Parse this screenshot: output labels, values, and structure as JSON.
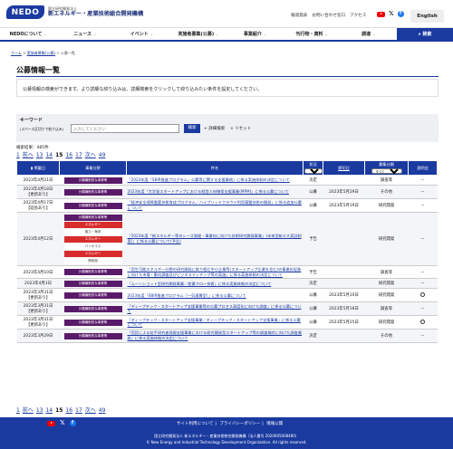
{
  "header": {
    "org_small": "国立研究開発法人",
    "org_name": "新エネルギー・産業技術総合開発機構",
    "logo": "NEDO",
    "links": [
      "報道発表",
      "お問い合わせ窓口",
      "アクセス"
    ],
    "lang": "English"
  },
  "gnav": {
    "items": [
      "NEDOについて",
      "ニュース",
      "イベント",
      "実施者募集(公募)",
      "事業紹介",
      "刊行物・資料",
      "調達"
    ],
    "search": "検索"
  },
  "breadcrumb": [
    "ホーム",
    "実施者募集(公募)",
    "公募一覧"
  ],
  "page": {
    "title": "公募情報一覧",
    "intro": "公募情報の検索ができます。より詳細な絞り込みは、詳細検索をクリックして絞り込みたい条件を設定してください。"
  },
  "search": {
    "label": "キーワード",
    "sublabel": "(スペース区切りで絞り込み)",
    "placeholder": "入力してください",
    "button": "検索",
    "detail": "詳細検索",
    "reset": "リセット"
  },
  "results": {
    "count": "検索結果：485件",
    "pager": [
      "1",
      "前へ",
      "13",
      "14",
      "15",
      "16",
      "17",
      "次へ",
      "49"
    ],
    "current": "15"
  },
  "table": {
    "headers": {
      "date": "掲載日",
      "category": "事業分野",
      "title": "件名",
      "status": "状況",
      "deadline": "締切日",
      "type": "募集分類",
      "briefing": "説明会",
      "select_all": "すべて"
    },
    "rows": [
      {
        "date": "2023年4月21日",
        "badges": [
          "分類横断的な事業等"
        ],
        "title": "「2023年度「SBIR推進プログラム」公募等に関する支援業務」に係る実施体制の決定について",
        "status": "決定",
        "deadline": "",
        "type": "調査等",
        "briefing": "ー"
      },
      {
        "date": "2023年4月18日",
        "date2": "【更新あり】",
        "badges": [
          "分類横断的な事業等"
        ],
        "title": "2023年度「大学発スタートアップにおける経営人材確保支援事業(MPM)」に係る公募について",
        "status": "公募",
        "deadline": "2023年5月29日",
        "type": "その他",
        "briefing": "ー"
      },
      {
        "date": "2023年4月17日",
        "date2": "【延長あり】",
        "badges": [
          "分類横断的な事業等"
        ],
        "title": "「経済安全保障重要技術育成プログラム／ハイブリッドクラウド利用基盤技術の開発」に係る追加公募について",
        "status": "公募",
        "deadline": "2023年5月19日",
        "type": "研究開発",
        "briefing": "ー"
      },
      {
        "date": "2023年4月12日",
        "badges": [
          "分類横断的な事業等",
          "エネルギー",
          "風力・海洋",
          "エネルギー",
          "バイオマス",
          "エネルギー",
          "熱利用"
        ],
        "title": "「2023年度「新エネルギー等のシーズ発掘・事業化に向けた技術研究開発事業」(未来型新エネ実証制度)」に係る公募について(予告)",
        "status": "予告",
        "deadline": "",
        "type": "研究開発",
        "briefing": "ー"
      },
      {
        "date": "2023年4月10日",
        "badges": [
          "分類横断的な事業等"
        ],
        "title": "「用生可能エネルギー分野の研究開発に取り組む中小企業等(スタートアップ企業を含む)の事業化促進に向けた市場・動向調査及びビジネスマッチング等の実施」に係る実施体制の決定について",
        "status": "予告",
        "deadline": "",
        "type": "調査等",
        "briefing": "ー"
      },
      {
        "date": "2023年4月3日",
        "badges": [
          "分類横断的な事業等"
        ],
        "title": "「ムーンショット型研究開発事業／産業フロー技術」に係る実施体制の決定について",
        "status": "決定",
        "deadline": "",
        "type": "研究開発",
        "briefing": "ー"
      },
      {
        "date": "2023年3月31日",
        "date2": "【更新あり】",
        "badges": [
          "分類横断的な事業等"
        ],
        "title": "2023年度「SBIR推進プログラム（一気通貫型）」に係る公募について",
        "status": "公募",
        "deadline": "2023年5月10日",
        "type": "研究開発",
        "briefing": "circle"
      },
      {
        "date": "2023年3月31日",
        "date2": "【更新あり】",
        "badges": [
          "分類横断的な事業等"
        ],
        "title": "「ディープテック・スタートアップ支援事業等の公募プロセス高度化に向けた調査」に係る公募について",
        "status": "公募",
        "deadline": "2023年5月18日",
        "type": "調査等",
        "briefing": "ー"
      },
      {
        "date": "2023年3月31日",
        "date2": "【更新あり】",
        "badges": [
          "分類横断的な事業等"
        ],
        "title": "「ディープテック・スタートアップ支援事業／ディープテック・スタートアップ支援事業」に係る公募について",
        "status": "公募",
        "deadline": "2023年5月25日",
        "type": "研究開発",
        "briefing": "circle"
      },
      {
        "date": "2023年3月29日",
        "badges": [
          "分類横断的な事業等"
        ],
        "title": "「官民による若手研究者発掘支援事業における研究開発型スタートアップ等の調査検討に向けた調査業務」に係る実施体制の決定について",
        "status": "決定",
        "deadline": "",
        "type": "その他",
        "briefing": "ー"
      }
    ]
  },
  "footer": {
    "links": [
      "サイト利用について",
      "プライバシーポリシー",
      "情報公開"
    ],
    "addr1": "国立研究開発法人 新エネルギー・産業技術総合開発機構（法人番号 2020005008480）",
    "copyright": "© New Energy and Industrial Technology Development Organization. All rights reserved."
  },
  "colors": {
    "brand": "#1a3aa0",
    "category_badge": "#5a1a6a",
    "energy_badge": "#d82c2c"
  }
}
